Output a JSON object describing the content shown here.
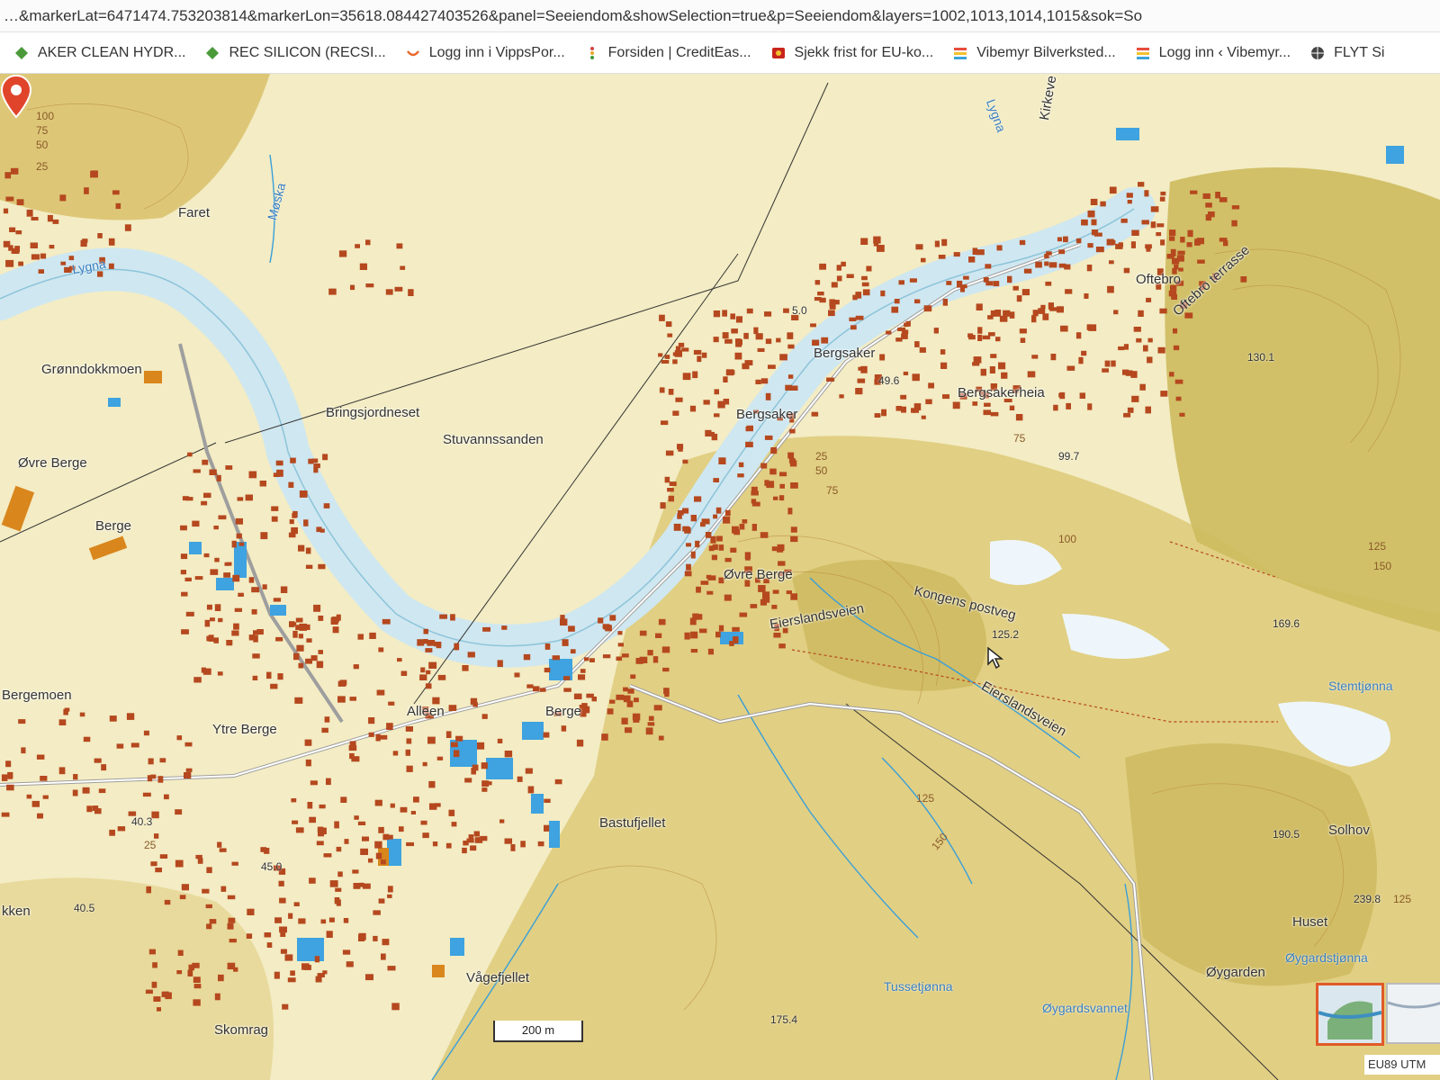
{
  "browser": {
    "url_text": "…&markerLat=6471474.753203814&markerLon=35618.084427403526&panel=Seeiendom&showSelection=true&p=Seeiendom&layers=1002,1013,1014,1015&sok=So",
    "bookmarks": [
      {
        "label": "AKER CLEAN HYDR...",
        "icon": "green-diamond-icon"
      },
      {
        "label": "REC SILICON (RECSI...",
        "icon": "green-diamond-icon"
      },
      {
        "label": "Logg inn i VippsPor...",
        "icon": "vipps-icon"
      },
      {
        "label": "Forsiden | CreditEas...",
        "icon": "dots-icon"
      },
      {
        "label": "Sjekk frist for EU-ko...",
        "icon": "badge-icon"
      },
      {
        "label": "Vibemyr Bilverksted...",
        "icon": "stripes-icon"
      },
      {
        "label": "Logg inn ‹ Vibemyr...",
        "icon": "stripes-icon"
      },
      {
        "label": "FLYT Si",
        "icon": "globe-icon"
      }
    ]
  },
  "map": {
    "place_names": {
      "faret": "Faret",
      "gronndokkmoen": "Grønndokkmoen",
      "ovre_berge_west": "Øvre Berge",
      "berge_west": "Berge",
      "bringsjordneset": "Bringsjordneset",
      "stuvannssanden": "Stuvannssanden",
      "bergsaker_1": "Bergsaker",
      "bergsaker_2": "Bergsaker",
      "bergsakerheia": "Bergsakerheia",
      "oftebro": "Oftebro",
      "oftebro_terrasse": "Oftebro terrasse",
      "ovre_berge_center": "Øvre Berge",
      "kongens_postveg": "Kongens postveg",
      "eierslandsveien_1": "Eierslandsveien",
      "eierslandsveien_2": "Eierslandsveien",
      "bergemoen": "Bergemoen",
      "ytre_berge": "Ytre Berge",
      "alleen": "Alleen",
      "berge_center": "Berge",
      "bastufjellet": "Bastufjellet",
      "vagefjellet": "Vågefjellet",
      "skomrag": "Skomrag",
      "solhov": "Solhov",
      "huset": "Huset",
      "oygarden": "Øygarden",
      "kirkeve": "Kirkeve",
      "kken": "kken"
    },
    "water_names": {
      "lygna_1": "Lygna",
      "lygna_2": "Lygna",
      "moska": "Møska",
      "stemtjonna": "Stemtjønna",
      "tussetjonna": "Tussetjønna",
      "oygardsvannet": "Øygardsvannet",
      "oygardstjonna": "Øygardstjønna"
    },
    "heights": {
      "h_49_6": "49.6",
      "h_99_7": "99.7",
      "h_130_1": "130.1",
      "h_125_2": "125.2",
      "h_169_6": "169.6",
      "h_190_5": "190.5",
      "h_239_8": "239.8",
      "h_40_3": "40.3",
      "h_45_0": "45.0",
      "h_40_5": "40.5",
      "h_175_4": "175.4",
      "h_5_0": "5.0"
    },
    "contours": {
      "c150": "150",
      "c125": "125",
      "c100": "100",
      "c75": "75",
      "c50": "50",
      "c25": "25"
    },
    "scale_label": "200 m",
    "projection_label": "EU89 UTM",
    "colors": {
      "land": "#f3ecc4",
      "forest": "#d6c674",
      "river": "#cfe7f0",
      "building_res": "#b5481e",
      "building_ind": "#3ea3e0"
    }
  }
}
